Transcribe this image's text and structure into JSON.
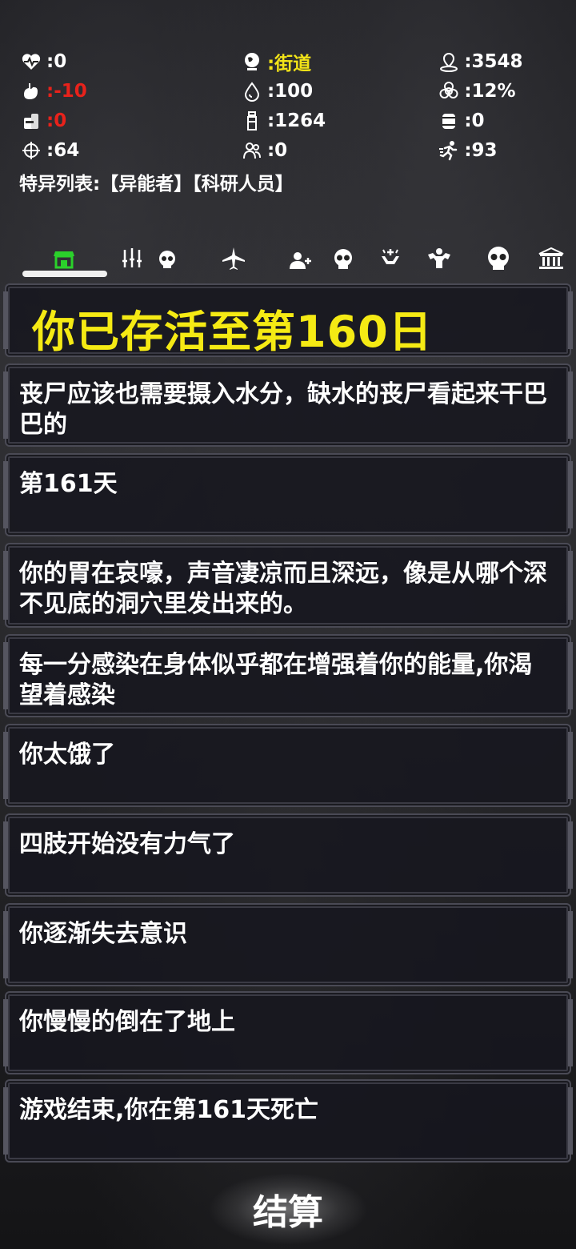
{
  "stats": {
    "health": {
      "icon": "heart-pulse-icon",
      "value": ":0"
    },
    "location": {
      "icon": "globe-icon",
      "value": ":街道",
      "color": "#f2e318"
    },
    "distance": {
      "icon": "map-pin-icon",
      "value": ":3548"
    },
    "hunger": {
      "icon": "stomach-icon",
      "value": ":-10",
      "color": "#e8221b"
    },
    "water": {
      "icon": "water-drop-icon",
      "value": ":100"
    },
    "infection": {
      "icon": "biohazard-icon",
      "value": ":12%"
    },
    "food": {
      "icon": "food-can-icon",
      "value": ":0",
      "color": "#e8221b"
    },
    "bottle": {
      "icon": "bottle-icon",
      "value": ":1264"
    },
    "barrel": {
      "icon": "barrel-icon",
      "value": ":0"
    },
    "aim": {
      "icon": "crosshair-icon",
      "value": ":64"
    },
    "survivors": {
      "icon": "people-icon",
      "value": ":0"
    },
    "stamina": {
      "icon": "running-icon",
      "value": ":93"
    },
    "special_list": "特异列表:【异能者】【科研人员】"
  },
  "tabs": [
    {
      "name": "shop-icon",
      "active": true
    },
    {
      "name": "weapons-icon"
    },
    {
      "name": "skull-small-icon"
    },
    {
      "name": "airplane-icon"
    },
    {
      "name": "add-person-icon"
    },
    {
      "name": "skull-icon"
    },
    {
      "name": "hand-heal-icon"
    },
    {
      "name": "muscle-icon"
    },
    {
      "name": "big-skull-icon"
    },
    {
      "name": "bank-icon"
    }
  ],
  "log": {
    "headline": "你已存活至第160日",
    "entries": [
      "丧尸应该也需要摄入水分，缺水的丧尸看起来干巴巴的",
      "第161天",
      "你的胃在哀嚎，声音凄凉而且深远，像是从哪个深不见底的洞穴里发出来的。",
      "每一分感染在身体似乎都在增强着你的能量,你渴望着感染",
      "你太饿了",
      "四肢开始没有力气了",
      "你逐渐失去意识",
      "你慢慢的倒在了地上",
      "游戏结束,你在第161天死亡"
    ]
  },
  "settle_button": "结算"
}
